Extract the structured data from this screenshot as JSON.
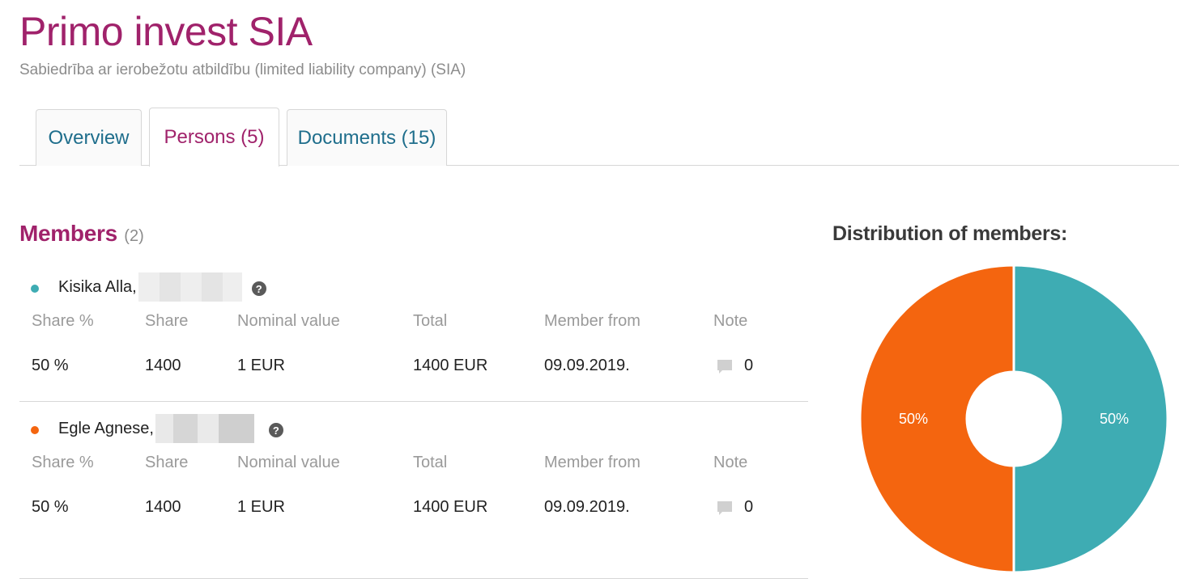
{
  "header": {
    "title": "Primo invest SIA",
    "subtitle": "Sabiedrība ar ierobežotu atbildību (limited liability company) (SIA)"
  },
  "tabs": [
    {
      "label": "Overview",
      "active": false
    },
    {
      "label": "Persons (5)",
      "active": true
    },
    {
      "label": "Documents (15)",
      "active": false
    }
  ],
  "members": {
    "heading": "Members",
    "count": "(2)",
    "columns": {
      "share_pct": "Share %",
      "share": "Share",
      "nominal": "Nominal value",
      "total": "Total",
      "member_from": "Member from",
      "note": "Note"
    },
    "items": [
      {
        "name": "Kisika Alla,",
        "color": "#3eacb3",
        "share_pct": "50 %",
        "share": "1400",
        "nominal": "1 EUR",
        "total": "1400 EUR",
        "member_from": "09.09.2019.",
        "note_count": "0"
      },
      {
        "name": "Egle Agnese,",
        "color": "#f4650f",
        "share_pct": "50 %",
        "share": "1400",
        "nominal": "1 EUR",
        "total": "1400 EUR",
        "member_from": "09.09.2019.",
        "note_count": "0"
      }
    ]
  },
  "chart": {
    "title": "Distribution of members:"
  },
  "chart_data": {
    "type": "pie",
    "title": "Distribution of members:",
    "donut": true,
    "slices": [
      {
        "value": 50,
        "label": "50%",
        "color": "#3eacb3"
      },
      {
        "value": 50,
        "label": "50%",
        "color": "#f4650f"
      }
    ]
  }
}
